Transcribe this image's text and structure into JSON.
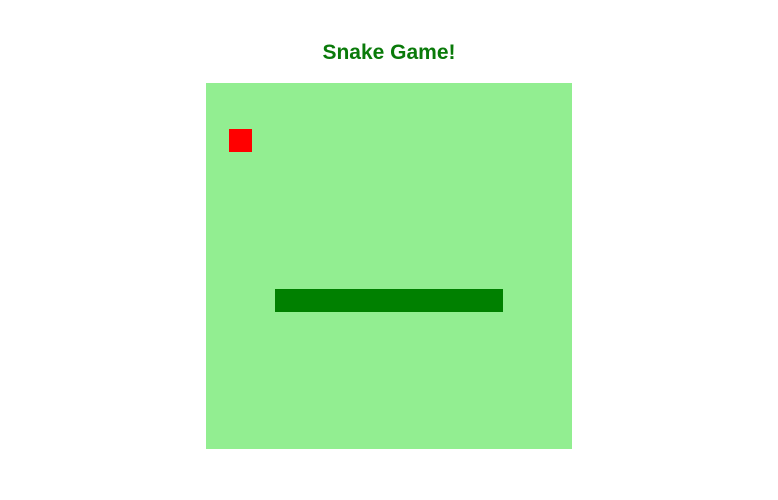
{
  "title": "Snake Game!",
  "colors": {
    "title": "#0a7a0a",
    "board": "#92ee91",
    "snake": "#008000",
    "food": "#ff0000"
  },
  "game": {
    "grid": {
      "cols": 16,
      "rows": 16
    },
    "food": {
      "col": 1,
      "row": 2
    },
    "snake": [
      {
        "col": 3,
        "row": 9
      },
      {
        "col": 4,
        "row": 9
      },
      {
        "col": 5,
        "row": 9
      },
      {
        "col": 6,
        "row": 9
      },
      {
        "col": 7,
        "row": 9
      },
      {
        "col": 8,
        "row": 9
      },
      {
        "col": 9,
        "row": 9
      },
      {
        "col": 10,
        "row": 9
      },
      {
        "col": 11,
        "row": 9
      },
      {
        "col": 12,
        "row": 9
      }
    ]
  }
}
